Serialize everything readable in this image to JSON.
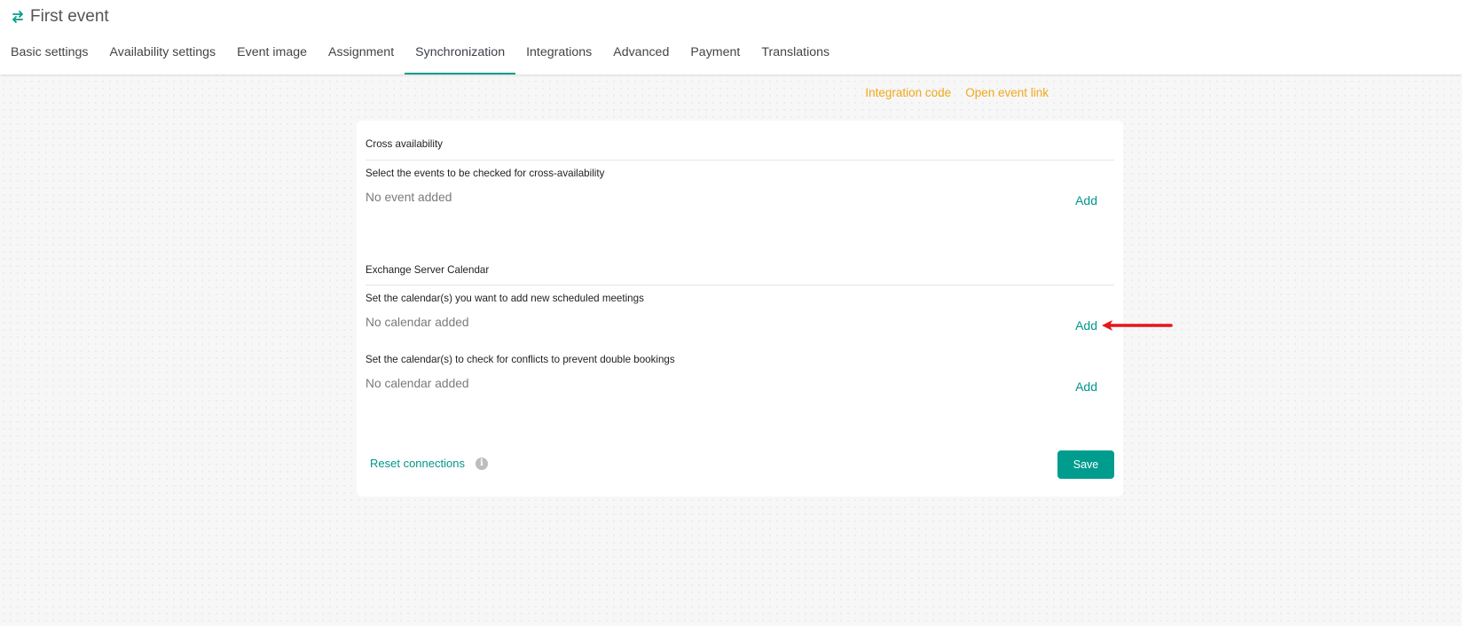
{
  "header": {
    "icon": "sync-icon",
    "title": "First event"
  },
  "tabs": [
    {
      "label": "Basic settings",
      "active": false
    },
    {
      "label": "Availability settings",
      "active": false
    },
    {
      "label": "Event image",
      "active": false
    },
    {
      "label": "Assignment",
      "active": false
    },
    {
      "label": "Synchronization",
      "active": true
    },
    {
      "label": "Integrations",
      "active": false
    },
    {
      "label": "Advanced",
      "active": false
    },
    {
      "label": "Payment",
      "active": false
    },
    {
      "label": "Translations",
      "active": false
    }
  ],
  "top_links": {
    "integration_code": "Integration code",
    "open_event_link": "Open event link"
  },
  "cross_availability": {
    "heading": "Cross availability",
    "label": "Select the events to be checked for cross-availability",
    "empty": "No event added",
    "add": "Add"
  },
  "exchange": {
    "heading": "Exchange Server Calendar",
    "new_meetings": {
      "label": "Set the calendar(s) you want to add new scheduled meetings",
      "empty": "No calendar added",
      "add": "Add"
    },
    "conflicts": {
      "label": "Set the calendar(s) to check for conflicts to prevent double bookings",
      "empty": "No calendar added",
      "add": "Add"
    }
  },
  "footer": {
    "reset": "Reset connections",
    "info_icon": "info-icon",
    "info_glyph": "i",
    "save": "Save"
  },
  "colors": {
    "accent": "#009d8e",
    "link_orange": "#f0a81c",
    "annotation_red": "#e8141b"
  }
}
